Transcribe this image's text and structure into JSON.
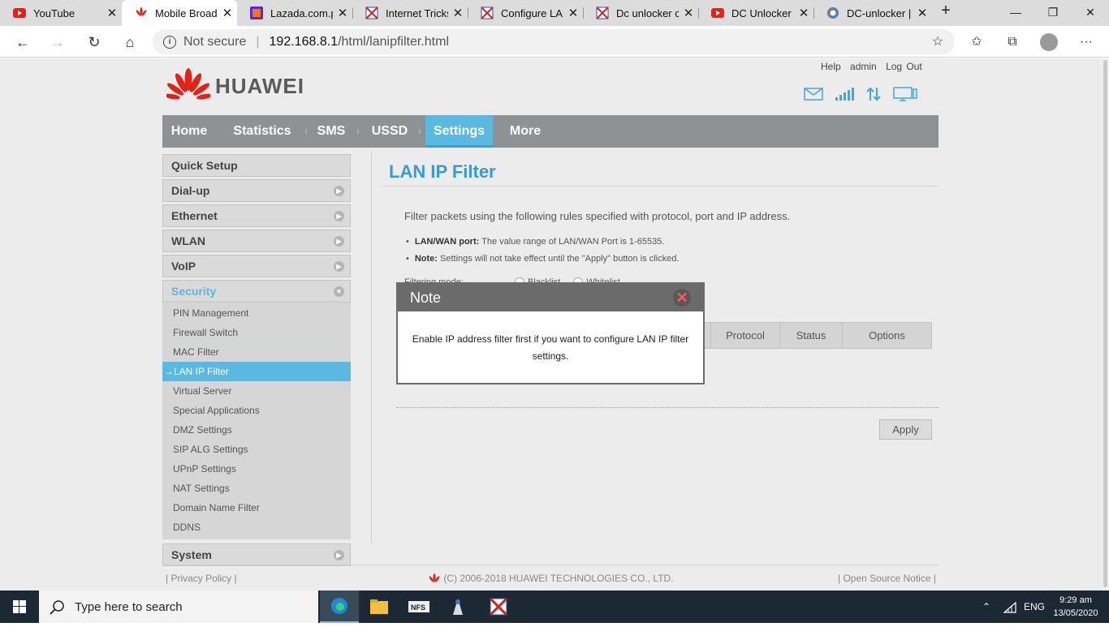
{
  "browser": {
    "tabs": [
      {
        "title": "YouTube",
        "icon": "youtube-icon"
      },
      {
        "title": "Mobile Broadb",
        "icon": "huawei-icon"
      },
      {
        "title": "Lazada.com.pl",
        "icon": "lazada-icon"
      },
      {
        "title": "Internet Tricks",
        "icon": "network-icon"
      },
      {
        "title": "Configure LAN",
        "icon": "network-icon"
      },
      {
        "title": "Dc unlocker cr",
        "icon": "network-icon"
      },
      {
        "title": "DC Unlocker C",
        "icon": "youtube-icon"
      },
      {
        "title": "DC-unlocker |",
        "icon": "dc-icon"
      }
    ],
    "address": {
      "security": "Not secure",
      "host": "192.168.8.1",
      "path": "/html/lanipfilter.html"
    }
  },
  "header": {
    "links": [
      "Help",
      "admin",
      "Log Out"
    ],
    "brand": "HUAWEI"
  },
  "nav": [
    "Home",
    "Statistics",
    "SMS",
    "USSD",
    "Settings",
    "More"
  ],
  "sidebar": {
    "menus": [
      "Quick Setup",
      "Dial-up",
      "Ethernet",
      "WLAN",
      "VoIP"
    ],
    "security": {
      "label": "Security",
      "items": [
        "PIN Management",
        "Firewall Switch",
        "MAC Filter",
        "→LAN IP Filter",
        "Virtual Server",
        "Special Applications",
        "DMZ Settings",
        "SIP ALG Settings",
        "UPnP Settings",
        "NAT Settings",
        "Domain Name Filter",
        "DDNS"
      ]
    },
    "system": "System"
  },
  "main": {
    "title": "LAN IP Filter",
    "description": "Filter packets using the following rules specified with protocol, port and IP address.",
    "bullets": [
      {
        "bold": "LAN/WAN port:",
        "text": " The value range of LAN/WAN Port is 1-65535."
      },
      {
        "bold": "Note:",
        "text": " Settings will not take effect until the \"Apply\" button is clicked."
      }
    ],
    "filtering_mode": {
      "label": "Filtering mode:",
      "options": [
        "Blacklist",
        "Whitelist"
      ]
    },
    "table_headers": [
      "Protocol",
      "Status",
      "Options"
    ],
    "apply": "Apply"
  },
  "modal": {
    "title": "Note",
    "message": "Enable IP address filter first if you want to configure LAN IP filter settings."
  },
  "footer": {
    "privacy": "Privacy Policy",
    "copyright": "(C) 2006-2018 HUAWEI TECHNOLOGIES CO., LTD.",
    "open_source": "Open Source Notice"
  },
  "taskbar": {
    "search_placeholder": "Type here to search",
    "lang": "ENG",
    "time": "9:29 am",
    "date": "13/05/2020"
  },
  "colors": {
    "accent": "#5bb8e0",
    "nav": "#8e9295",
    "brand_red": "#e2231a"
  }
}
